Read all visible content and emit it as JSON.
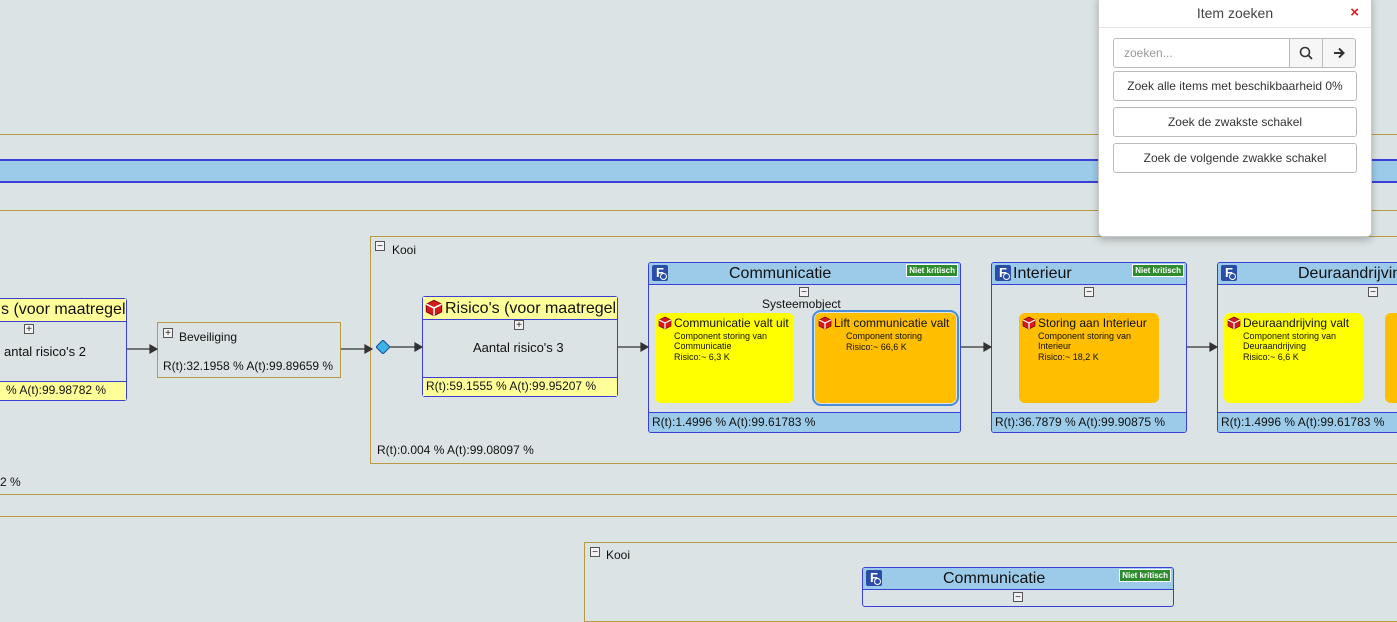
{
  "groups": {
    "kooi_main": {
      "label": "Kooi",
      "toggle": "−",
      "stats": "R(t):0.004 % A(t):99.08097 %"
    },
    "kooi_bottom": {
      "label": "Kooi",
      "toggle": "−"
    },
    "outer_left_stat": "2 %"
  },
  "left_risk_node": {
    "title": "s (voor maatregel",
    "toggle": "+",
    "count": "antal risico's  2",
    "stats": "% A(t):99.98782 %"
  },
  "beveiliging": {
    "toggle": "+",
    "label": "Beveiliging",
    "stats": "R(t):32.1958 % A(t):99.89659 %"
  },
  "risk_node": {
    "title": "Risico's (voor maatregel",
    "toggle": "+",
    "count": "Aantal risico's  3",
    "stats": "R(t):59.1555 % A(t):99.95207 %"
  },
  "systems": [
    {
      "title": "Communicatie",
      "badge": "Niet kritisch",
      "toggle": "−",
      "subtitle": "Systeemobject",
      "stats": "R(t):1.4996 % A(t):99.61783 %",
      "components": [
        {
          "title": "Communicatie valt uit",
          "desc": "Component storing van Communicatie",
          "risk": "Risico:~ 6,3 K"
        },
        {
          "title": "Lift communicatie valt",
          "desc": "Component storing",
          "risk": "Risico:~ 66,6 K"
        }
      ]
    },
    {
      "title": "Interieur",
      "badge": "Niet kritisch",
      "toggle": "−",
      "stats": "R(t):36.7879 % A(t):99.90875 %",
      "components": [
        {
          "title": "Storing aan Interieur",
          "desc": "Component storing van Interieur",
          "risk": "Risico:~ 18,2 K"
        }
      ]
    },
    {
      "title": "Deuraandrijvin",
      "toggle": "−",
      "stats": "R(t):1.4996 % A(t):99.61783 %",
      "components": [
        {
          "title": "Deuraandrijving valt",
          "desc": "Component storing van Deuraandrijving",
          "risk": "Risico:~ 6,6 K"
        }
      ]
    },
    {
      "title": "Communicatie",
      "badge": "Niet kritisch",
      "toggle": "−"
    }
  ],
  "dialog": {
    "title": "Item zoeken",
    "close_icon": "×",
    "search_placeholder": "zoeken...",
    "buttons": [
      "Zoek alle items met beschikbaarheid 0%",
      "Zoek de zwakste schakel",
      "Zoek de volgende zwakke schakel"
    ]
  },
  "colors": {
    "system_header": "#9ccbe9",
    "risk_yellow": "#ffff99",
    "component_yellow": "#ffff00",
    "component_orange": "#ffbe00",
    "badge_green": "#2e8b2e"
  }
}
